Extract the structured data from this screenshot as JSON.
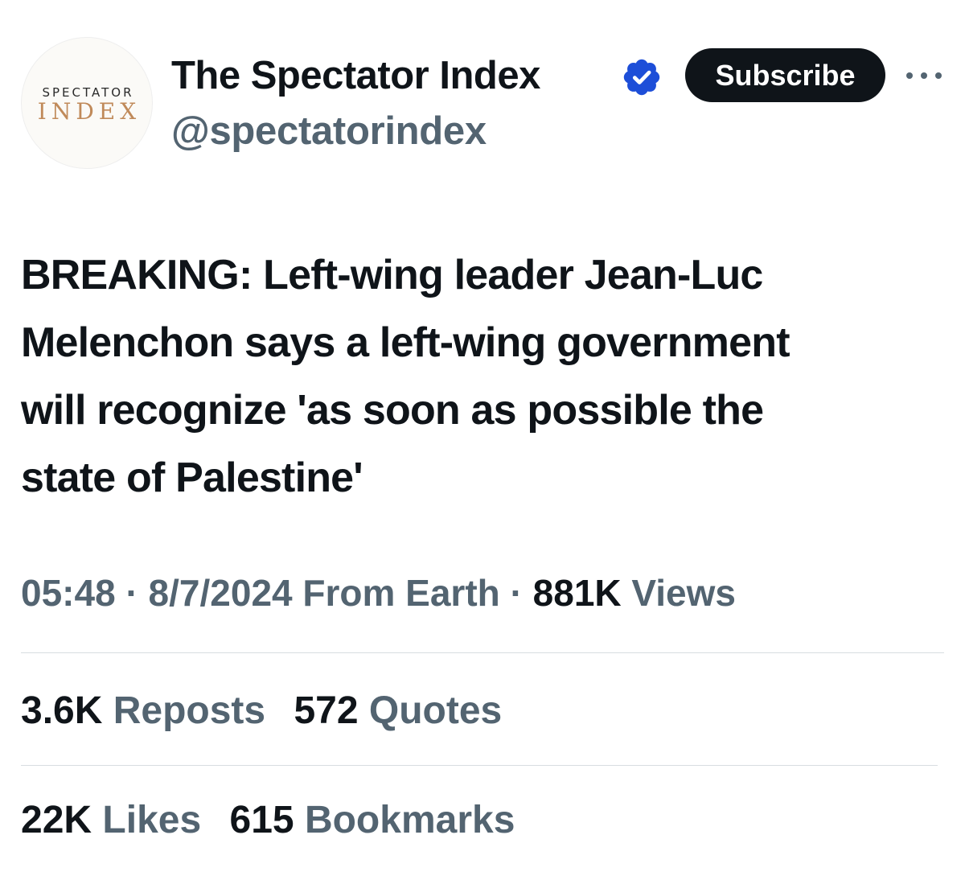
{
  "account": {
    "avatar_top": "SPECTATOR",
    "avatar_bottom": "INDEX",
    "display_name": "The Spectator Index",
    "handle": "@spectatorindex",
    "verified_badge_color": "#1d4ed8",
    "verified_icon": "verified-badge-icon"
  },
  "actions": {
    "subscribe_label": "Subscribe",
    "more_icon": "more-options-icon"
  },
  "tweet": {
    "lines": [
      "BREAKING: Left-wing leader Jean-Luc",
      "Melenchon says a left-wing government",
      "will recognize 'as soon as possible the",
      "state of Palestine'"
    ]
  },
  "meta": {
    "time": "05:48",
    "sep1": "·",
    "date": "8/7/2024",
    "source": "From Earth",
    "sep2": "·",
    "views_count": "881K",
    "views_label": "Views"
  },
  "stats": {
    "reposts_count": "3.6K",
    "reposts_label": "Reposts",
    "quotes_count": "572",
    "quotes_label": "Quotes",
    "likes_count": "22K",
    "likes_label": "Likes",
    "bookmarks_count": "615",
    "bookmarks_label": "Bookmarks"
  },
  "colors": {
    "text_primary": "#0f1419",
    "text_secondary": "#536471",
    "avatar_accent": "#c08a5a",
    "divider": "#d8dde1"
  }
}
